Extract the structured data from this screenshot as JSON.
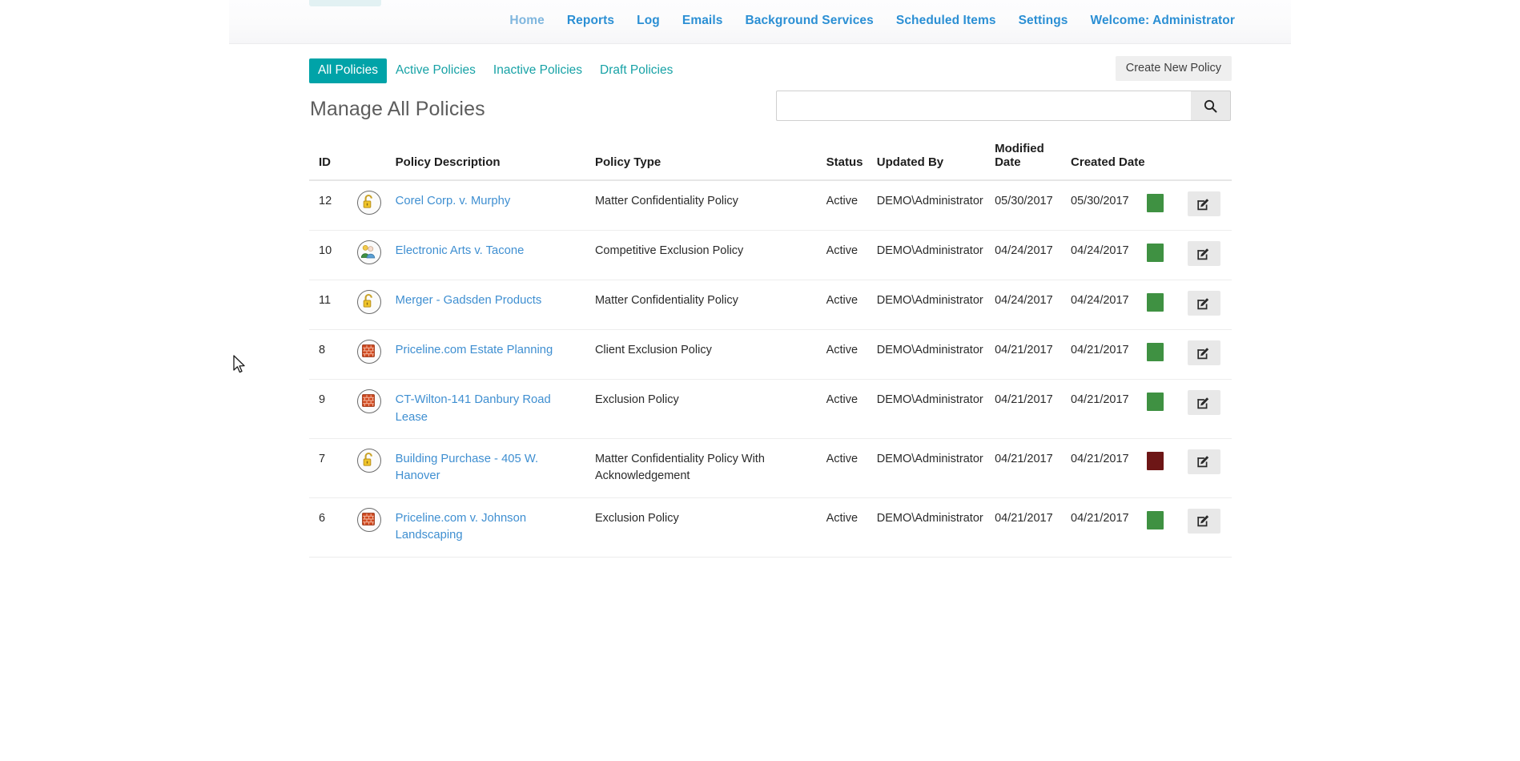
{
  "header": {
    "logo_name": "app-logo",
    "nav": [
      {
        "label": "Home",
        "active": true
      },
      {
        "label": "Reports",
        "active": false
      },
      {
        "label": "Log",
        "active": false
      },
      {
        "label": "Emails",
        "active": false
      },
      {
        "label": "Background Services",
        "active": false
      },
      {
        "label": "Scheduled Items",
        "active": false
      },
      {
        "label": "Settings",
        "active": false
      },
      {
        "label": "Welcome: Administrator",
        "active": false
      }
    ]
  },
  "tabs": [
    {
      "label": "All Policies",
      "active": true
    },
    {
      "label": "Active Policies",
      "active": false
    },
    {
      "label": "Inactive Policies",
      "active": false
    },
    {
      "label": "Draft Policies",
      "active": false
    }
  ],
  "toolbar": {
    "create_label": "Create New Policy"
  },
  "page": {
    "title": "Manage All Policies"
  },
  "search": {
    "value": "",
    "placeholder": "",
    "icon": "search-icon"
  },
  "table": {
    "columns": [
      "ID",
      "",
      "Policy Description",
      "Policy Type",
      "Status",
      "Updated By",
      "Modified Date",
      "Created Date",
      "",
      ""
    ],
    "rows": [
      {
        "id": "12",
        "icon": "unlocked-padlock-icon",
        "description": "Corel Corp. v. Murphy",
        "type": "Matter Confidentiality Policy",
        "status": "Active",
        "updated_by": "DEMO\\Administrator",
        "modified_date": "05/30/2017",
        "created_date": "05/30/2017",
        "flag_color": "#3f9142",
        "action": "edit-icon"
      },
      {
        "id": "10",
        "icon": "people-group-icon",
        "description": "Electronic Arts v. Tacone",
        "type": "Competitive Exclusion Policy",
        "status": "Active",
        "updated_by": "DEMO\\Administrator",
        "modified_date": "04/24/2017",
        "created_date": "04/24/2017",
        "flag_color": "#3f9142",
        "action": "edit-icon"
      },
      {
        "id": "11",
        "icon": "unlocked-padlock-icon",
        "description": "Merger - Gadsden Products",
        "type": "Matter Confidentiality Policy",
        "status": "Active",
        "updated_by": "DEMO\\Administrator",
        "modified_date": "04/24/2017",
        "created_date": "04/24/2017",
        "flag_color": "#3f9142",
        "action": "edit-icon"
      },
      {
        "id": "8",
        "icon": "brick-wall-icon",
        "description": "Priceline.com Estate Planning",
        "type": "Client Exclusion Policy",
        "status": "Active",
        "updated_by": "DEMO\\Administrator",
        "modified_date": "04/21/2017",
        "created_date": "04/21/2017",
        "flag_color": "#3f9142",
        "action": "edit-icon"
      },
      {
        "id": "9",
        "icon": "brick-wall-icon",
        "description": "CT-Wilton-141 Danbury Road Lease",
        "type": "Exclusion Policy",
        "status": "Active",
        "updated_by": "DEMO\\Administrator",
        "modified_date": "04/21/2017",
        "created_date": "04/21/2017",
        "flag_color": "#3f9142",
        "action": "edit-icon"
      },
      {
        "id": "7",
        "icon": "unlocked-padlock-icon",
        "description": "Building Purchase - 405 W. Hanover",
        "type": "Matter Confidentiality Policy With Acknowledgement",
        "status": "Active",
        "updated_by": "DEMO\\Administrator",
        "modified_date": "04/21/2017",
        "created_date": "04/21/2017",
        "flag_color": "#6d1616",
        "action": "edit-icon"
      },
      {
        "id": "6",
        "icon": "brick-wall-icon",
        "description": "Priceline.com v. Johnson Landscaping",
        "type": "Exclusion Policy",
        "status": "Active",
        "updated_by": "DEMO\\Administrator",
        "modified_date": "04/21/2017",
        "created_date": "04/21/2017",
        "flag_color": "#3f9142",
        "action": "edit-icon"
      }
    ]
  },
  "colors": {
    "accent_teal": "#00a3a8",
    "nav_link": "#2b8fd4",
    "nav_active": "#7fb6de",
    "link": "#3f8fd1",
    "status_green": "#3f9142",
    "status_maroon": "#6d1616"
  }
}
